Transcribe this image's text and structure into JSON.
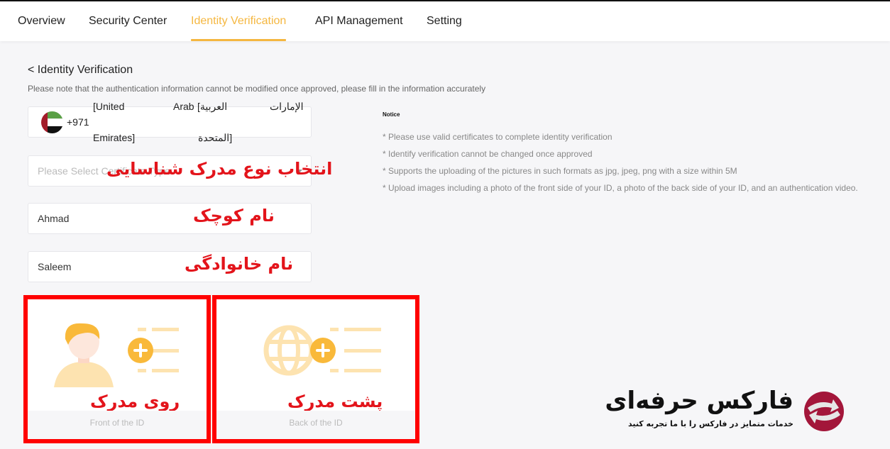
{
  "nav": {
    "tabs": [
      {
        "label": "Overview",
        "active": false
      },
      {
        "label": "Security Center",
        "active": false
      },
      {
        "label": "Identity Verification",
        "active": true
      },
      {
        "label": "API Management",
        "active": false
      },
      {
        "label": "Setting",
        "active": false
      }
    ],
    "accent_color": "#f5b740"
  },
  "page": {
    "back_title": "< Identity Verification",
    "note": "Please note that the authentication information cannot be modified once approved, please fill in the information accurately"
  },
  "form": {
    "country": {
      "flag_icon": "uae-flag-icon",
      "dial_code": "+971",
      "name_parts": [
        "[United",
        "Arab",
        "العربية]",
        "الإمارات",
        "Emirates]",
        "[المتحدة"
      ]
    },
    "certificate_type": {
      "placeholder": "Please Select Certificate Type",
      "value": ""
    },
    "first_name": {
      "value": "Ahmad"
    },
    "last_name": {
      "value": "Saleem"
    }
  },
  "annotations": {
    "certificate_type": "انتخاب نوع مدرک شناسایی",
    "first_name": "نام کوچک",
    "last_name": "نام خانوادگی",
    "front": "روی مدرک",
    "back": "پشت مدرک",
    "color": "#e3141b"
  },
  "notice": {
    "title": "Notice",
    "items": [
      "* Please use valid certificates to complete identity verification",
      "* Identify verification cannot be changed once approved",
      "* Supports the uploading of the pictures in such formats as jpg, jpeg, png with a size within 5M",
      "* Upload images including a photo of the front side of your ID, a photo of the back side of your ID, and an authentication video."
    ]
  },
  "uploads": {
    "front": {
      "label": "Front of the ID",
      "icon": "person-add-icon"
    },
    "back": {
      "label": "Back of the ID",
      "icon": "globe-add-icon"
    }
  },
  "watermark": {
    "title": "فارکس حرفه‌ای",
    "subtitle": "خدمات متمایز در فارکس را با ما تجربه کنید"
  }
}
